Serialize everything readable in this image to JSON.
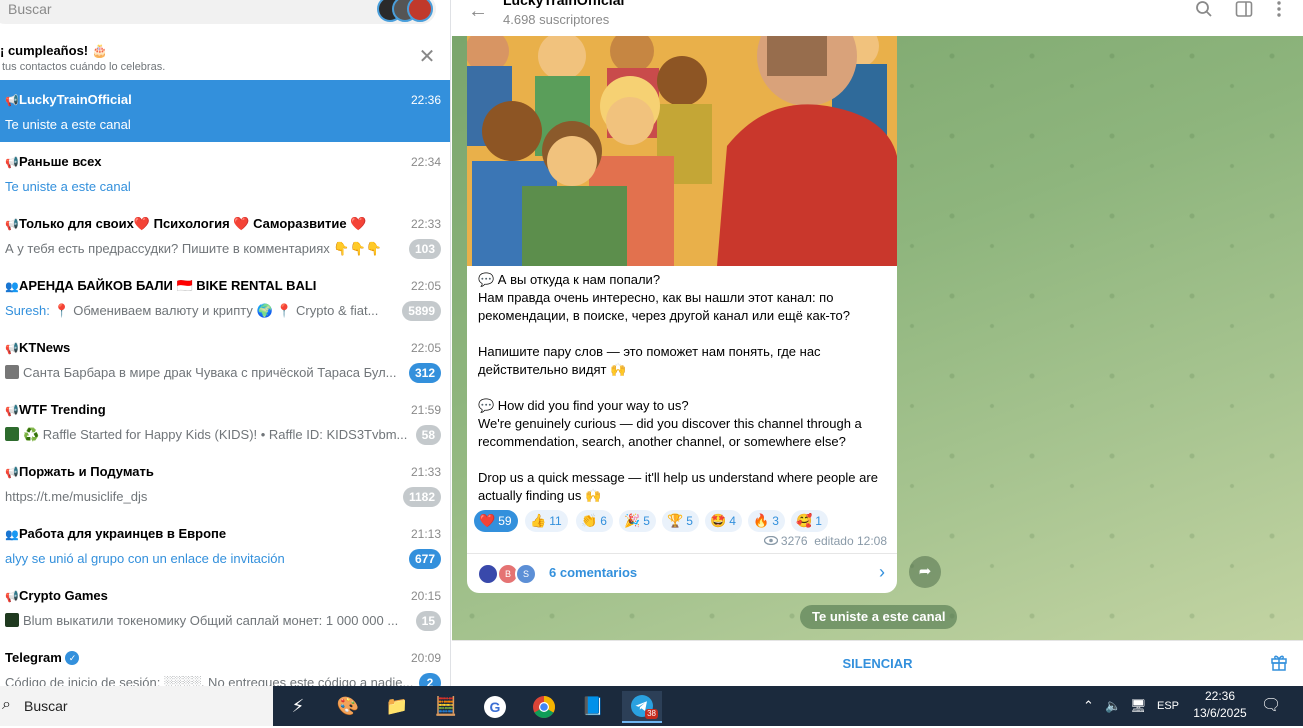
{
  "sidebar": {
    "search_placeholder": "Buscar",
    "birthday": {
      "title": "¡ cumpleaños! 🎂",
      "subtitle": "tus contactos cuándo lo celebras."
    },
    "chats": [
      {
        "icon": "📢",
        "name": "LuckyTrainOfficial",
        "time": "22:36",
        "message": "Te uniste a este canal",
        "badge": ""
      },
      {
        "icon": "📢",
        "name": "Раньше всех",
        "time": "22:34",
        "message": "Te uniste a este canal",
        "badge": ""
      },
      {
        "icon": "📢",
        "name": "Только для своих❤️ Психология ❤️ Саморазвитие ❤️",
        "time": "22:33",
        "message": "А у тебя есть предрассудки? Пишите в комментариях 👇👇👇",
        "badge": "103"
      },
      {
        "icon": "👥",
        "name": "АРЕНДА БАЙКОВ БАЛИ 🇮🇩 BIKE RENTAL BALI",
        "time": "22:05",
        "sender": "Suresh:",
        "message": "📍 Обмениваем валюту и крипту 🌍 📍 Crypto & fiat...",
        "badge": "5899"
      },
      {
        "icon": "📢",
        "name": "KTNews",
        "time": "22:05",
        "message": "Санта Барбара в мире драк  Чувака с причёской Тараса Бул...",
        "badge": "312"
      },
      {
        "icon": "📢",
        "name": "WTF Trending",
        "time": "21:59",
        "message": "♻️ Raffle Started for Happy Kids (KIDS)! • Raffle ID: KIDS3Tvbm...",
        "badge": "58"
      },
      {
        "icon": "📢",
        "name": "Поржать и Подумать",
        "time": "21:33",
        "message": "https://t.me/musiclife_djs",
        "badge": "1182"
      },
      {
        "icon": "👥",
        "name": "Работа для украинцев в Европе",
        "time": "21:13",
        "message": "alyy se unió al grupo con un enlace de invitación",
        "badge": "677"
      },
      {
        "icon": "📢",
        "name": "Crypto Games",
        "time": "20:15",
        "message": "Blum выкатили токеномику  Общий саплай монет: 1 000 000 ...",
        "badge": "15"
      },
      {
        "icon": "",
        "name": "Telegram",
        "time": "20:09",
        "message": "Código de inicio de sesión: ░░░░. No entregues este código a nadie...",
        "badge": "2"
      }
    ]
  },
  "header": {
    "channel_name": "LuckyTrainOfficial",
    "subscribers": "4.698 suscriptores"
  },
  "post": {
    "text": "💬 А вы откуда к нам попали?\nНам правда очень интересно, как вы нашли этот канал: по рекомендации, в поиске, через другой канал или ещё как-то?\n\nНапишите пару слов — это поможет нам понять, где нас действительно видят 🙌\n\n💬 How did you find your way to us?\nWe're genuinely curious — did you discover this channel through a recommendation, search, another channel, or somewhere else?\n\nDrop us a quick message — it'll help us understand where people are actually finding us 🙌",
    "reactions": [
      {
        "emoji": "❤️",
        "count": "59",
        "mine": true
      },
      {
        "emoji": "👍",
        "count": "11"
      },
      {
        "emoji": "👏",
        "count": "6"
      },
      {
        "emoji": "🎉",
        "count": "5"
      },
      {
        "emoji": "🏆",
        "count": "5"
      },
      {
        "emoji": "🤩",
        "count": "4"
      },
      {
        "emoji": "🔥",
        "count": "3"
      },
      {
        "emoji": "🥰",
        "count": "1"
      }
    ],
    "views": "3276",
    "edited": "editado 12:08",
    "comments_label": "6 comentarios",
    "comment_avatars": [
      "",
      "B",
      "S"
    ]
  },
  "service_message": "Te uniste a este canal",
  "bottom": {
    "mute_label": "SILENCIAR"
  },
  "taskbar": {
    "search_placeholder": "Buscar",
    "telegram_badge": "38",
    "language": "ESP",
    "time": "22:36",
    "date": "13/6/2025"
  },
  "colors": {
    "accent": "#3390dc",
    "chat_bg": "#8eb57d",
    "taskbar": "#1b2a3d"
  }
}
